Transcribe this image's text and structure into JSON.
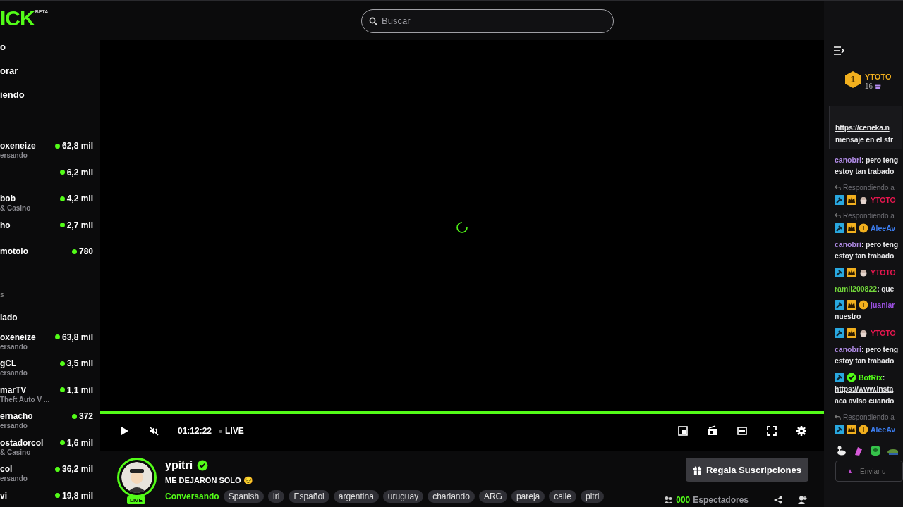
{
  "logo": {
    "text": "ICK",
    "tag": "BETA"
  },
  "search": {
    "placeholder": "Buscar"
  },
  "sidebar": {
    "nav": [
      {
        "label": "o"
      },
      {
        "label": "orar"
      },
      {
        "label": "iendo"
      }
    ],
    "sections": [
      {
        "channels": [
          {
            "name": "oxeneize",
            "category": "ersando",
            "viewers": "62,8 mil"
          },
          {
            "viewers": "6,2 mil"
          },
          {
            "name": "bob",
            "category": "& Casino",
            "viewers": "4,2 mil"
          },
          {
            "name": "ho",
            "viewers": "2,7 mil"
          },
          {
            "name": "motolo",
            "viewers": "780"
          }
        ]
      },
      {
        "subtitle": "s",
        "title": "lado",
        "channels": [
          {
            "name": "oxeneize",
            "category": "ersando",
            "viewers": "63,8 mil"
          },
          {
            "name": "gCL",
            "category": "ersando",
            "viewers": "3,5 mil"
          },
          {
            "name": "marTV",
            "category": "Theft Auto V ...",
            "viewers": "1,1 mil"
          },
          {
            "name": "ernacho",
            "category": "ersando",
            "viewers": "372"
          },
          {
            "name": "ostadorcol",
            "category": "& Casino",
            "viewers": "1,6 mil"
          },
          {
            "name": "col",
            "category": "ersando",
            "viewers": "36,2 mil"
          },
          {
            "name": "vi",
            "viewers": "19,8 mil"
          }
        ]
      }
    ]
  },
  "player": {
    "progress": {
      "level": 1
    },
    "time": "01:12:22",
    "live": "LIVE",
    "left_controls": [
      {
        "kind": "play"
      },
      {
        "kind": "mute"
      }
    ],
    "right_controls": [
      {
        "kind": "miniplayer"
      },
      {
        "kind": "theater"
      },
      {
        "kind": "wide"
      },
      {
        "kind": "fullscreen"
      },
      {
        "kind": "settings"
      }
    ]
  },
  "stream": {
    "live_badge": "LIVE",
    "channel": "ypitri",
    "verified": true,
    "title": "ME DEJARON SOLO 😔",
    "category": "Conversando",
    "tags": [
      "Spanish",
      "irl",
      "Español",
      "argentina",
      "uruguay",
      "charlando",
      "ARG",
      "pareja",
      "calle",
      "pitri"
    ],
    "gift_button": "Regala Suscripciones",
    "viewers": "000",
    "viewers_label": "Espectadores"
  },
  "chat": {
    "pinned_user": {
      "rank": "1",
      "name": "YTOTO",
      "count": "16"
    },
    "messages": [
      {
        "kind": "card",
        "lines": [
          {
            "text": "https://ceneka.n",
            "link": true
          },
          {
            "text": "mensaje en el str",
            "link": false
          }
        ]
      },
      {
        "kind": "message",
        "user": "canobri",
        "color": "#b18ce6",
        "text": ": pero teng",
        "lines": [
          {
            "text": "estoy tan trabado",
            "link": false
          }
        ]
      },
      {
        "kind": "reply",
        "reply_label": "Respondiendo a",
        "badges": [
          {
            "kind": "mod"
          },
          {
            "kind": "vip"
          },
          {
            "kind": "hand"
          }
        ],
        "user": "YTOTO",
        "color": "#e8174f"
      },
      {
        "kind": "reply",
        "reply_label": "Respondiendo a",
        "badges": [
          {
            "kind": "mod"
          },
          {
            "kind": "vip"
          },
          {
            "kind": "coin"
          }
        ],
        "user": "AleeAv",
        "color": "#3d7ef0"
      },
      {
        "kind": "message",
        "user": "canobri",
        "color": "#b18ce6",
        "text": ": pero teng",
        "lines": [
          {
            "text": "estoy tan trabado",
            "link": false
          }
        ]
      },
      {
        "kind": "message",
        "badges": [
          {
            "kind": "mod"
          },
          {
            "kind": "vip"
          },
          {
            "kind": "hand"
          }
        ],
        "user": "YTOTO",
        "color": "#e8174f"
      },
      {
        "kind": "message",
        "user": "ramii200822",
        "color": "#72d73a",
        "text": ": que"
      },
      {
        "kind": "message",
        "badges": [
          {
            "kind": "mod"
          },
          {
            "kind": "vip"
          },
          {
            "kind": "coin"
          }
        ],
        "user": "juanlar",
        "color": "#9b4fe0",
        "lines": [
          {
            "text": "nuestro",
            "link": false
          }
        ]
      },
      {
        "kind": "message",
        "badges": [
          {
            "kind": "mod"
          },
          {
            "kind": "vip"
          },
          {
            "kind": "hand"
          }
        ],
        "user": "YTOTO",
        "color": "#e8174f"
      },
      {
        "kind": "message",
        "user": "canobri",
        "color": "#b18ce6",
        "text": ": pero teng",
        "lines": [
          {
            "text": "estoy tan trabado",
            "link": false
          }
        ]
      },
      {
        "kind": "message",
        "badges": [
          {
            "kind": "mod"
          },
          {
            "kind": "verified"
          }
        ],
        "user": "BotRix",
        "color": "#53fc18",
        "text": ":",
        "lines": [
          {
            "text": "https://www.insta",
            "link": true
          },
          {
            "text": "aca aviso cuando",
            "link": false
          }
        ]
      },
      {
        "kind": "reply",
        "reply_label": "Respondiendo a",
        "badges": [
          {
            "kind": "mod"
          },
          {
            "kind": "vip"
          },
          {
            "kind": "coin"
          }
        ],
        "user": "AleeAv",
        "color": "#3d7ef0"
      }
    ],
    "input": {
      "placeholder": "Enviar u"
    }
  }
}
